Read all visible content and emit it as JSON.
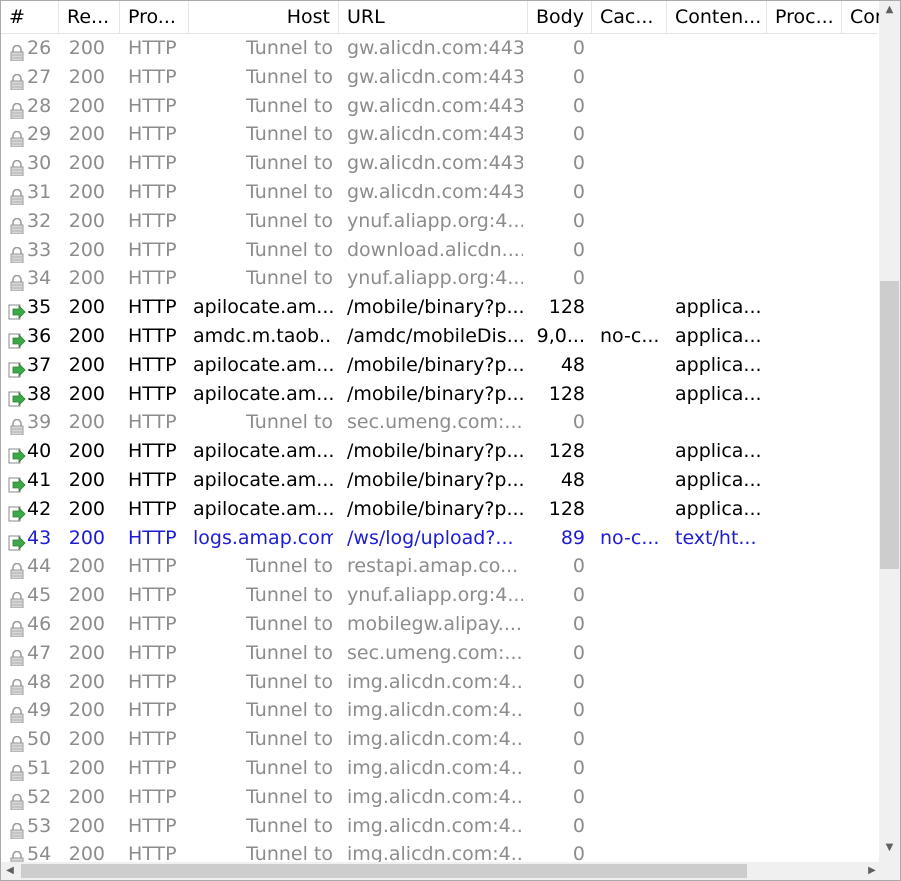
{
  "columns": {
    "num": "#",
    "result": "Re...",
    "protocol": "Pro...",
    "host": "Host",
    "url": "URL",
    "body": "Body",
    "caching": "Cac...",
    "content_type": "Conten...",
    "process": "Proc...",
    "comments": "Cor"
  },
  "rows": [
    {
      "num": "26",
      "result": "200",
      "protocol": "HTTP",
      "host": "Tunnel to",
      "url": "gw.alicdn.com:443",
      "body": "0",
      "caching": "",
      "content_type": "",
      "kind": "tunnel"
    },
    {
      "num": "27",
      "result": "200",
      "protocol": "HTTP",
      "host": "Tunnel to",
      "url": "gw.alicdn.com:443",
      "body": "0",
      "caching": "",
      "content_type": "",
      "kind": "tunnel"
    },
    {
      "num": "28",
      "result": "200",
      "protocol": "HTTP",
      "host": "Tunnel to",
      "url": "gw.alicdn.com:443",
      "body": "0",
      "caching": "",
      "content_type": "",
      "kind": "tunnel"
    },
    {
      "num": "29",
      "result": "200",
      "protocol": "HTTP",
      "host": "Tunnel to",
      "url": "gw.alicdn.com:443",
      "body": "0",
      "caching": "",
      "content_type": "",
      "kind": "tunnel"
    },
    {
      "num": "30",
      "result": "200",
      "protocol": "HTTP",
      "host": "Tunnel to",
      "url": "gw.alicdn.com:443",
      "body": "0",
      "caching": "",
      "content_type": "",
      "kind": "tunnel"
    },
    {
      "num": "31",
      "result": "200",
      "protocol": "HTTP",
      "host": "Tunnel to",
      "url": "gw.alicdn.com:443",
      "body": "0",
      "caching": "",
      "content_type": "",
      "kind": "tunnel"
    },
    {
      "num": "32",
      "result": "200",
      "protocol": "HTTP",
      "host": "Tunnel to",
      "url": "ynuf.aliapp.org:4...",
      "body": "0",
      "caching": "",
      "content_type": "",
      "kind": "tunnel"
    },
    {
      "num": "33",
      "result": "200",
      "protocol": "HTTP",
      "host": "Tunnel to",
      "url": "download.alicdn....",
      "body": "0",
      "caching": "",
      "content_type": "",
      "kind": "tunnel"
    },
    {
      "num": "34",
      "result": "200",
      "protocol": "HTTP",
      "host": "Tunnel to",
      "url": "ynuf.aliapp.org:4...",
      "body": "0",
      "caching": "",
      "content_type": "",
      "kind": "tunnel"
    },
    {
      "num": "35",
      "result": "200",
      "protocol": "HTTP",
      "host": "apilocate.am...",
      "url": "/mobile/binary?p...",
      "body": "128",
      "caching": "",
      "content_type": "applica...",
      "kind": "active"
    },
    {
      "num": "36",
      "result": "200",
      "protocol": "HTTP",
      "host": "amdc.m.taob...",
      "url": "/amdc/mobileDis...",
      "body": "9,0...",
      "caching": "no-c...",
      "content_type": "applica...",
      "kind": "active"
    },
    {
      "num": "37",
      "result": "200",
      "protocol": "HTTP",
      "host": "apilocate.am...",
      "url": "/mobile/binary?p...",
      "body": "48",
      "caching": "",
      "content_type": "applica...",
      "kind": "active"
    },
    {
      "num": "38",
      "result": "200",
      "protocol": "HTTP",
      "host": "apilocate.am...",
      "url": "/mobile/binary?p...",
      "body": "128",
      "caching": "",
      "content_type": "applica...",
      "kind": "active"
    },
    {
      "num": "39",
      "result": "200",
      "protocol": "HTTP",
      "host": "Tunnel to",
      "url": "sec.umeng.com:...",
      "body": "0",
      "caching": "",
      "content_type": "",
      "kind": "tunnel"
    },
    {
      "num": "40",
      "result": "200",
      "protocol": "HTTP",
      "host": "apilocate.am...",
      "url": "/mobile/binary?p...",
      "body": "128",
      "caching": "",
      "content_type": "applica...",
      "kind": "active"
    },
    {
      "num": "41",
      "result": "200",
      "protocol": "HTTP",
      "host": "apilocate.am...",
      "url": "/mobile/binary?p...",
      "body": "48",
      "caching": "",
      "content_type": "applica...",
      "kind": "active"
    },
    {
      "num": "42",
      "result": "200",
      "protocol": "HTTP",
      "host": "apilocate.am...",
      "url": "/mobile/binary?p...",
      "body": "128",
      "caching": "",
      "content_type": "applica...",
      "kind": "active"
    },
    {
      "num": "43",
      "result": "200",
      "protocol": "HTTP",
      "host": "logs.amap.com",
      "url": "/ws/log/upload?...",
      "body": "89",
      "caching": "no-c...",
      "content_type": "text/ht...",
      "kind": "selected"
    },
    {
      "num": "44",
      "result": "200",
      "protocol": "HTTP",
      "host": "Tunnel to",
      "url": "restapi.amap.co...",
      "body": "0",
      "caching": "",
      "content_type": "",
      "kind": "tunnel"
    },
    {
      "num": "45",
      "result": "200",
      "protocol": "HTTP",
      "host": "Tunnel to",
      "url": "ynuf.aliapp.org:4...",
      "body": "0",
      "caching": "",
      "content_type": "",
      "kind": "tunnel"
    },
    {
      "num": "46",
      "result": "200",
      "protocol": "HTTP",
      "host": "Tunnel to",
      "url": "mobilegw.alipay....",
      "body": "0",
      "caching": "",
      "content_type": "",
      "kind": "tunnel"
    },
    {
      "num": "47",
      "result": "200",
      "protocol": "HTTP",
      "host": "Tunnel to",
      "url": "sec.umeng.com:...",
      "body": "0",
      "caching": "",
      "content_type": "",
      "kind": "tunnel"
    },
    {
      "num": "48",
      "result": "200",
      "protocol": "HTTP",
      "host": "Tunnel to",
      "url": "img.alicdn.com:4...",
      "body": "0",
      "caching": "",
      "content_type": "",
      "kind": "tunnel"
    },
    {
      "num": "49",
      "result": "200",
      "protocol": "HTTP",
      "host": "Tunnel to",
      "url": "img.alicdn.com:4...",
      "body": "0",
      "caching": "",
      "content_type": "",
      "kind": "tunnel"
    },
    {
      "num": "50",
      "result": "200",
      "protocol": "HTTP",
      "host": "Tunnel to",
      "url": "img.alicdn.com:4...",
      "body": "0",
      "caching": "",
      "content_type": "",
      "kind": "tunnel"
    },
    {
      "num": "51",
      "result": "200",
      "protocol": "HTTP",
      "host": "Tunnel to",
      "url": "img.alicdn.com:4...",
      "body": "0",
      "caching": "",
      "content_type": "",
      "kind": "tunnel"
    },
    {
      "num": "52",
      "result": "200",
      "protocol": "HTTP",
      "host": "Tunnel to",
      "url": "img.alicdn.com:4...",
      "body": "0",
      "caching": "",
      "content_type": "",
      "kind": "tunnel"
    },
    {
      "num": "53",
      "result": "200",
      "protocol": "HTTP",
      "host": "Tunnel to",
      "url": "img.alicdn.com:4...",
      "body": "0",
      "caching": "",
      "content_type": "",
      "kind": "tunnel"
    },
    {
      "num": "54",
      "result": "200",
      "protocol": "HTTP",
      "host": "Tunnel to",
      "url": "img.alicdn.com:4...",
      "body": "0",
      "caching": "",
      "content_type": "",
      "kind": "tunnel"
    }
  ],
  "icons": {
    "tunnel": "lock-icon",
    "active": "request-arrow-icon",
    "selected": "request-arrow-icon"
  },
  "colors": {
    "tunnel_text": "#8c8c8c",
    "active_text": "#000000",
    "selected_text": "#1c1cd6",
    "arrow_green": "#3da84a"
  },
  "vertical_scroll_position": 0.33
}
